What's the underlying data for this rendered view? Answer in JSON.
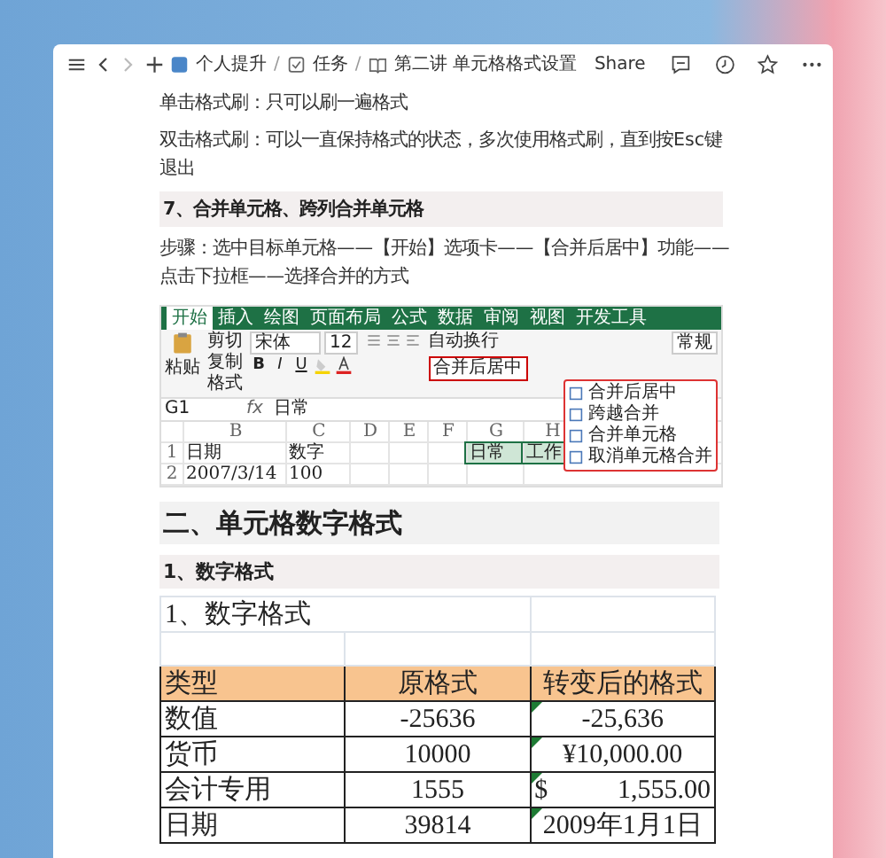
{
  "toolbar": {
    "nav": {
      "back_disabled": false,
      "forward_disabled": true
    },
    "separator": "/",
    "breadcrumbs": [
      {
        "kind": "app",
        "label": "个人提升"
      },
      {
        "kind": "task",
        "label": "任务"
      },
      {
        "kind": "doc",
        "label": "第二讲 单元格格式设置"
      }
    ],
    "share": "Share"
  },
  "blocks": [
    {
      "kind": "text",
      "text": "单击格式刷：只可以刷一遍格式"
    },
    {
      "kind": "text",
      "text": "双击格式刷：可以一直保持格式的状态，多次使用格式刷，直到按Esc键退出"
    },
    {
      "kind": "heading",
      "text": "7、合并单元格、跨列合并单元格"
    },
    {
      "kind": "text",
      "text": "步骤：选中目标单元格——【开始】选项卡——【合并后居中】功能——点击下拉框——选择合并的方式"
    }
  ],
  "excel": {
    "tabs": [
      {
        "label": "开始",
        "selected": true
      },
      {
        "label": "插入",
        "selected": false
      },
      {
        "label": "绘图",
        "selected": false
      },
      {
        "label": "页面布局",
        "selected": false
      },
      {
        "label": "公式",
        "selected": false
      },
      {
        "label": "数据",
        "selected": false
      },
      {
        "label": "审阅",
        "selected": false
      },
      {
        "label": "视图",
        "selected": false
      },
      {
        "label": "开发工具",
        "selected": false
      }
    ],
    "format_buttons": [
      "B",
      "I",
      "U"
    ],
    "fx": "fx",
    "paste": "粘贴",
    "clipboard": [
      "剪切",
      "复制",
      "格式"
    ],
    "font": "宋体",
    "size": "12",
    "wrap": "自动换行",
    "merge": "合并后居中",
    "number_format": "常规",
    "cell_ref": "G1",
    "formula": "日常",
    "columns": [
      "B",
      "C",
      "D",
      "E",
      "F",
      "G",
      "H"
    ],
    "rows": [
      {
        "num": "1",
        "cells": [
          "日期",
          "数字",
          "",
          "",
          "",
          "日常",
          "工作"
        ]
      },
      {
        "num": "2",
        "cells": [
          "2007/3/14",
          "100",
          "",
          "",
          "",
          "",
          ""
        ]
      }
    ],
    "menu": [
      "合并后居中",
      "跨越合并",
      "合并单元格",
      "取消单元格合并"
    ]
  },
  "section": {
    "title": "二、单元格数字格式",
    "subtitle": "1、数字格式"
  },
  "table": {
    "title": "1、数字格式",
    "columns": [
      "类型",
      "原格式",
      "转变后的格式"
    ],
    "rows": [
      {
        "type": "数值",
        "original": "-25636",
        "converted": "-25,636",
        "flag": true
      },
      {
        "type": "货币",
        "original": "10000",
        "converted": "¥10,000.00",
        "flag": true
      },
      {
        "type": "会计专用",
        "original": "1555",
        "symbol": "$",
        "converted": "1,555.00",
        "flag": true
      },
      {
        "type": "日期",
        "original": "39814",
        "converted": "2009年1月1日",
        "flag": true
      }
    ]
  }
}
